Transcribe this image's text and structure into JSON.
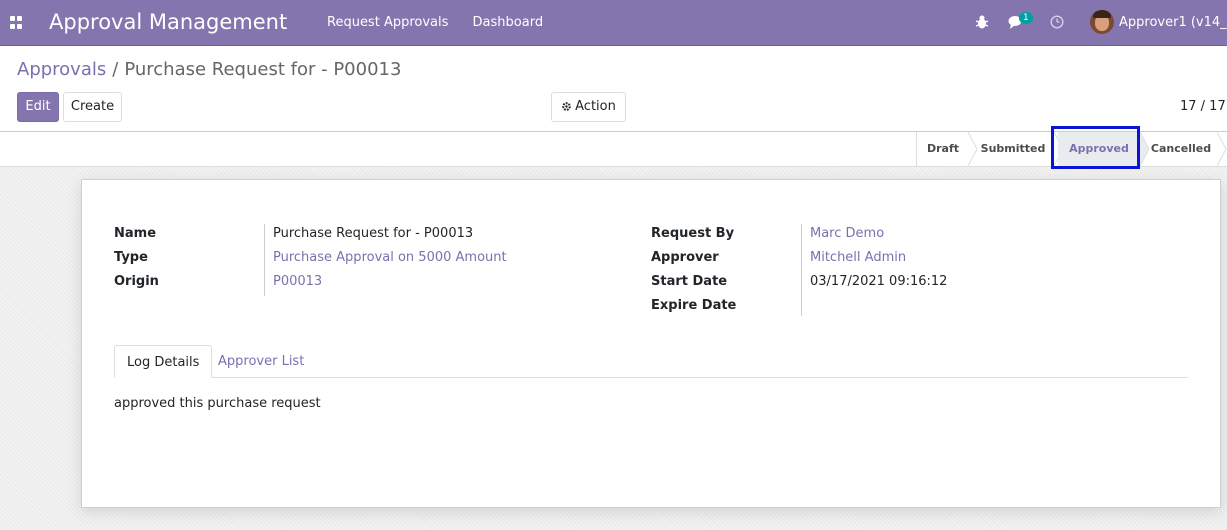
{
  "navbar": {
    "app_title": "Approval Management",
    "menu": [
      "Request Approvals",
      "Dashboard"
    ],
    "chat_badge": "1",
    "user_name": "Approver1 (v14_ap"
  },
  "breadcrumb": {
    "parent": "Approvals",
    "separator": "/",
    "current": "Purchase Request for - P00013"
  },
  "buttons": {
    "edit": "Edit",
    "create": "Create",
    "action": "Action"
  },
  "pager": "17 / 17",
  "statusbar": {
    "stages": [
      "Draft",
      "Submitted",
      "Approved",
      "Cancelled"
    ],
    "active": "Approved"
  },
  "form": {
    "left": [
      {
        "label": "Name",
        "value": "Purchase Request for - P00013",
        "link": false
      },
      {
        "label": "Type",
        "value": "Purchase Approval on 5000 Amount",
        "link": true
      },
      {
        "label": "Origin",
        "value": "P00013",
        "link": true
      }
    ],
    "right": [
      {
        "label": "Request By",
        "value": "Marc Demo",
        "link": true
      },
      {
        "label": "Approver",
        "value": "Mitchell Admin",
        "link": true
      },
      {
        "label": "Start Date",
        "value": "03/17/2021 09:16:12",
        "link": false
      },
      {
        "label": "Expire Date",
        "value": "",
        "link": false
      }
    ]
  },
  "tabs": [
    "Log Details",
    "Approver List"
  ],
  "log_text": "approved this purchase request",
  "colors": {
    "brand": "#8575ae",
    "link": "#7c6fb0",
    "highlight": "#0a13d6",
    "badge": "#00a09d"
  }
}
